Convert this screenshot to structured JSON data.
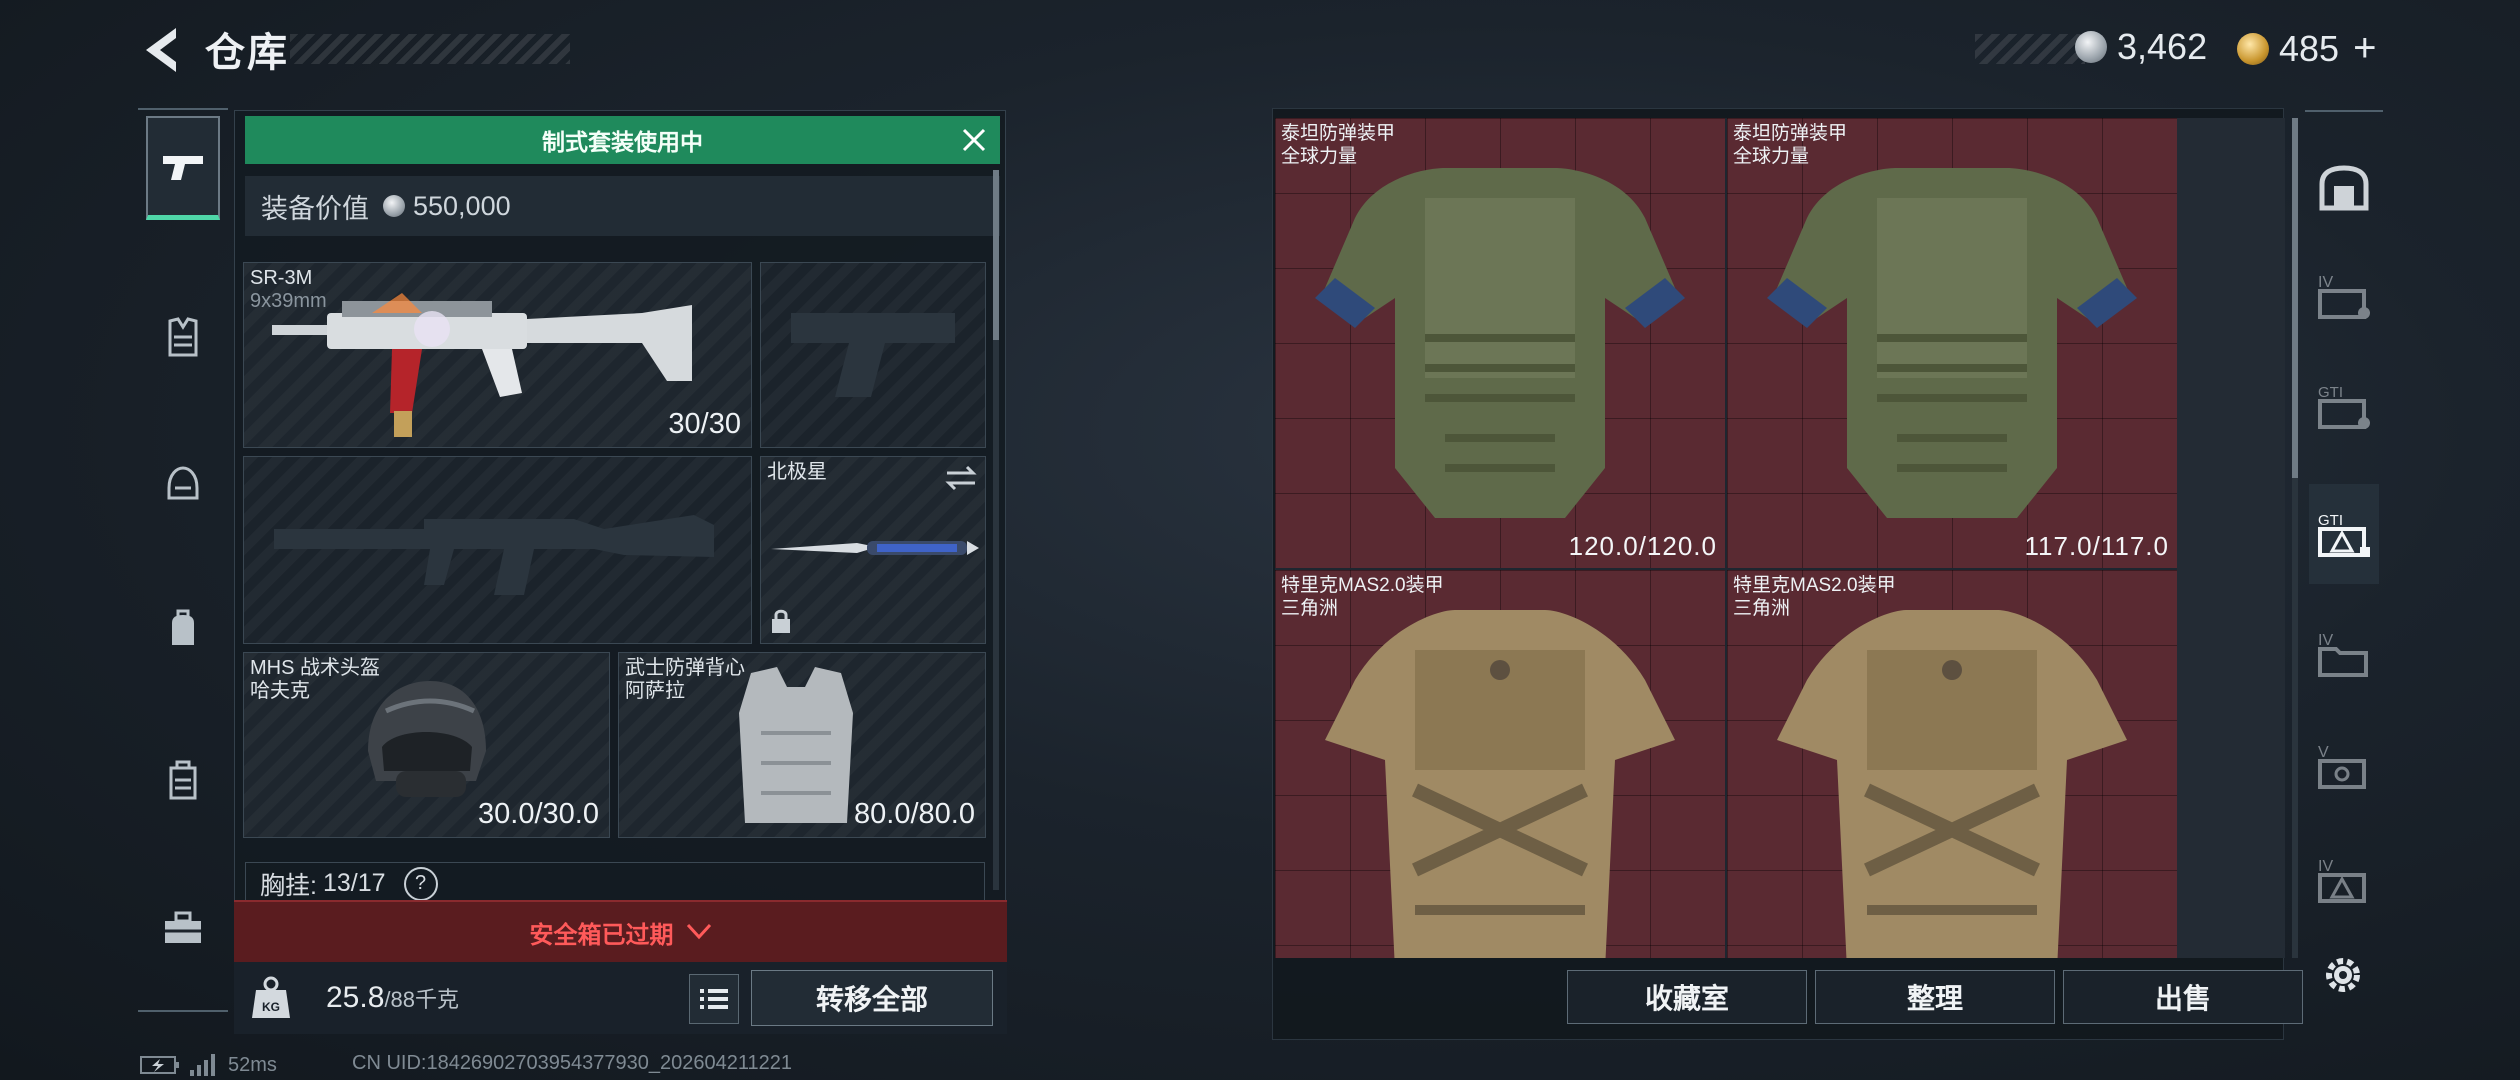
{
  "header": {
    "title": "仓库"
  },
  "currency": [
    {
      "icon": "silver-coin-icon",
      "value": "3,462"
    },
    {
      "icon": "gold-coin-icon",
      "value": "485"
    }
  ],
  "currency_plus": "+",
  "left_nav": [
    {
      "icon": "pistol-icon",
      "active": true
    },
    {
      "icon": "armor-rig-icon"
    },
    {
      "icon": "helmet-icon"
    },
    {
      "icon": "backpack-icon"
    },
    {
      "icon": "case-icon"
    },
    {
      "icon": "toolbox-icon"
    }
  ],
  "equip": {
    "banner": "制式套装使用中",
    "value_label": "装备价值",
    "value": "550,000",
    "slots": {
      "primary": {
        "name": "SR-3M",
        "sub": "9x39mm",
        "durability": "30/30"
      },
      "melee": {
        "name": "北极星"
      },
      "helmet": {
        "name": "MHS 战术头盔",
        "sub": "哈夫克",
        "durability": "30.0/30.0"
      },
      "armor": {
        "name": "武士防弹背心",
        "sub": "阿萨拉",
        "durability": "80.0/80.0"
      }
    },
    "chest_label": "胸挂:",
    "chest_value": "13/17",
    "help": "?",
    "warning": "安全箱已过期",
    "weight_value": "25.8",
    "weight_max": "/88千克",
    "move_all": "转移全部"
  },
  "storage": {
    "items": [
      {
        "name": "泰坦防弹装甲",
        "sub": "全球力量",
        "durability": "120.0/120.0",
        "color": "#5a2a32"
      },
      {
        "name": "泰坦防弹装甲",
        "sub": "全球力量",
        "durability": "117.0/117.0",
        "color": "#5a2a32"
      },
      {
        "name": "特里克MAS2.0装甲",
        "sub": "三角洲",
        "color": "#5a2a32"
      },
      {
        "name": "特里克MAS2.0装甲",
        "sub": "三角洲",
        "color": "#5a2a32"
      }
    ],
    "buttons": {
      "collection": "收藏室",
      "arrange": "整理",
      "sell": "出售"
    }
  },
  "right_nav": [
    {
      "icon": "container-all-icon"
    },
    {
      "icon": "tier-iv-case-icon",
      "label": "IV"
    },
    {
      "icon": "gti-case-icon",
      "label": "GTI"
    },
    {
      "icon": "gti-warning-case-icon",
      "label": "GTI",
      "active": true
    },
    {
      "icon": "tier-iv-folder-icon",
      "label": "IV"
    },
    {
      "icon": "tier-v-case-icon",
      "label": "V"
    },
    {
      "icon": "tier-iv-warning-icon",
      "label": "IV"
    }
  ],
  "status": {
    "ping": "52ms",
    "uid": "CN UID:18426902703954377930_202604211221"
  }
}
